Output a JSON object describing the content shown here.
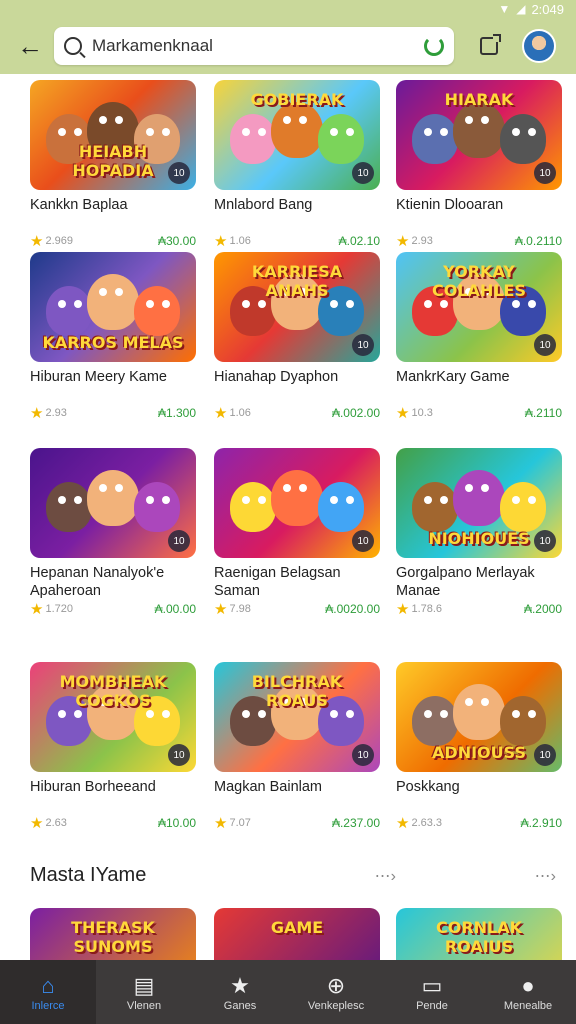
{
  "status": {
    "time": "2:049",
    "wifi_icon": "wifi-icon",
    "signal_icon": "signal-icon",
    "battery_icon": "battery-icon"
  },
  "topbar": {
    "search_value": "Markamenknaal",
    "back_icon": "arrow-left-icon",
    "refresh_icon": "refresh-icon",
    "cast_icon": "open-external-icon",
    "avatar_icon": "avatar"
  },
  "grid": [
    {
      "name": "Kankkn Baplaa",
      "rating": "2.969",
      "price": "₳30.00",
      "thumb_title": "HEIABH HOPADIA",
      "thumb_pos": "bottom",
      "badge": "10",
      "bg": "linear-gradient(135deg,#f5a623,#e94e1b 45%,#3bb0e6)",
      "c": [
        "#c9713c",
        "#7a4a2a",
        "#e0a070"
      ]
    },
    {
      "name": "Mnlabord Bang",
      "rating": "1.06",
      "price": "₳.02.10",
      "thumb_title": "GOBIERAK",
      "thumb_pos": "top",
      "badge": "10",
      "bg": "linear-gradient(135deg,#f7d33a,#5ac8fa 55%,#4caf50)",
      "c": [
        "#f49ac1",
        "#e07b2a",
        "#7bd45a"
      ]
    },
    {
      "name": "Ktienin Dlooaran",
      "rating": "2.93",
      "price": "₳.0.2110",
      "thumb_title": "HIARAK",
      "thumb_pos": "top",
      "badge": "10",
      "bg": "linear-gradient(135deg,#6a1b9a,#d81b60 50%,#ff9800)",
      "c": [
        "#5b6fb0",
        "#8a5a3a",
        "#555"
      ]
    },
    {
      "name": "Hiburan Meery Kame",
      "rating": "2.93",
      "price": "₳1.300",
      "thumb_title": "KARROS MELAS",
      "thumb_pos": "bottom",
      "badge": "",
      "bg": "linear-gradient(135deg,#1e3a8a,#7e57c2 50%,#ff6f00)",
      "c": [
        "#7e57c2",
        "#f2b27a",
        "#ff7043"
      ]
    },
    {
      "name": "Hianahap Dyaphon",
      "rating": "1.06",
      "price": "₳.002.00",
      "thumb_title": "KARRIESA ANAHS",
      "thumb_pos": "top",
      "badge": "10",
      "bg": "linear-gradient(135deg,#ff9800,#e53935 50%,#26a69a)",
      "c": [
        "#c0392b",
        "#f2b27a",
        "#2980b9"
      ]
    },
    {
      "name": "MankrKary Game",
      "rating": "10.3",
      "price": "₳.2110",
      "thumb_title": "YORKAY COLAHLES",
      "thumb_pos": "top",
      "badge": "10",
      "bg": "linear-gradient(135deg,#4fc3f7,#8bc34a 60%,#ffca28)",
      "c": [
        "#e53935",
        "#f2b27a",
        "#3949ab"
      ]
    },
    {
      "name": "Hepanan Nanalyok'e Apaheroan",
      "rating": "1.720",
      "price": "₳.00.00",
      "thumb_title": "",
      "thumb_pos": "bottom",
      "badge": "10",
      "bg": "linear-gradient(135deg,#4a148c,#7b1fa2 50%,#ff7043)",
      "c": [
        "#6d4c41",
        "#f2b27a",
        "#ab47bc"
      ]
    },
    {
      "name": "Raenigan Belagsan Saman",
      "rating": "7.98",
      "price": "₳.0020.00",
      "thumb_title": "",
      "thumb_pos": "bottom",
      "badge": "10",
      "bg": "linear-gradient(135deg,#8e24aa,#d81b60 55%,#ffb300)",
      "c": [
        "#fdd835",
        "#ff7043",
        "#42a5f5"
      ]
    },
    {
      "name": "Gorgalpano Merlayak Manae",
      "rating": "1.78.6",
      "price": "₳.2000",
      "thumb_title": "NIOHIOUES",
      "thumb_pos": "bottom",
      "badge": "10",
      "bg": "linear-gradient(135deg,#43a047,#26c6da 55%,#fdd835)",
      "c": [
        "#a1662f",
        "#ab47bc",
        "#fdd835"
      ]
    },
    {
      "name": "Hiburan Borheeand",
      "rating": "2.63",
      "price": "₳10.00",
      "thumb_title": "MOMBHEAK COGKOS",
      "thumb_pos": "top",
      "badge": "10",
      "bg": "linear-gradient(135deg,#ec407a,#8bc34a 60%,#fdd835)",
      "c": [
        "#7e57c2",
        "#f2b27a",
        "#fdd835"
      ]
    },
    {
      "name": "Magkan Bainlam",
      "rating": "7.07",
      "price": "₳.237.00",
      "thumb_title": "BILCHRAK ROAUS",
      "thumb_pos": "top",
      "badge": "10",
      "bg": "linear-gradient(135deg,#26c6da,#ff7043 55%,#ab47bc)",
      "c": [
        "#6d4c41",
        "#f2b27a",
        "#7e57c2"
      ]
    },
    {
      "name": "Poskkang",
      "rating": "2.63.3",
      "price": "₳.2.910",
      "thumb_title": "ADNIOUSS",
      "thumb_pos": "bottom",
      "badge": "10",
      "bg": "linear-gradient(135deg,#ffca28,#ef6c00 55%,#66bb6a)",
      "c": [
        "#8d6e63",
        "#f2b27a",
        "#a1662f"
      ]
    }
  ],
  "section": {
    "title": "Masta IYame",
    "more_icon": "arrow-right-icon"
  },
  "preview": [
    {
      "title": "THERASK SUNOMS",
      "bg": "linear-gradient(135deg,#7b1fa2,#ff9800)"
    },
    {
      "title": "GAME",
      "bg": "linear-gradient(135deg,#e53935,#4a148c)"
    },
    {
      "title": "CORNLAK ROAIUS",
      "bg": "linear-gradient(135deg,#26c6da,#fdd835)"
    }
  ],
  "nav": [
    {
      "label": "Inlerce",
      "icon": "home-icon",
      "glyph": "⌂",
      "active": true
    },
    {
      "label": "Vlenen",
      "icon": "list-icon",
      "glyph": "▤",
      "active": false
    },
    {
      "label": "Ganes",
      "icon": "star-icon",
      "glyph": "★",
      "active": false
    },
    {
      "label": "Venkeplesc",
      "icon": "search-icon",
      "glyph": "⊕",
      "active": false
    },
    {
      "label": "Pende",
      "icon": "tv-icon",
      "glyph": "▭",
      "active": false
    },
    {
      "label": "Menealbe",
      "icon": "profile-icon",
      "glyph": "●",
      "active": false
    }
  ]
}
